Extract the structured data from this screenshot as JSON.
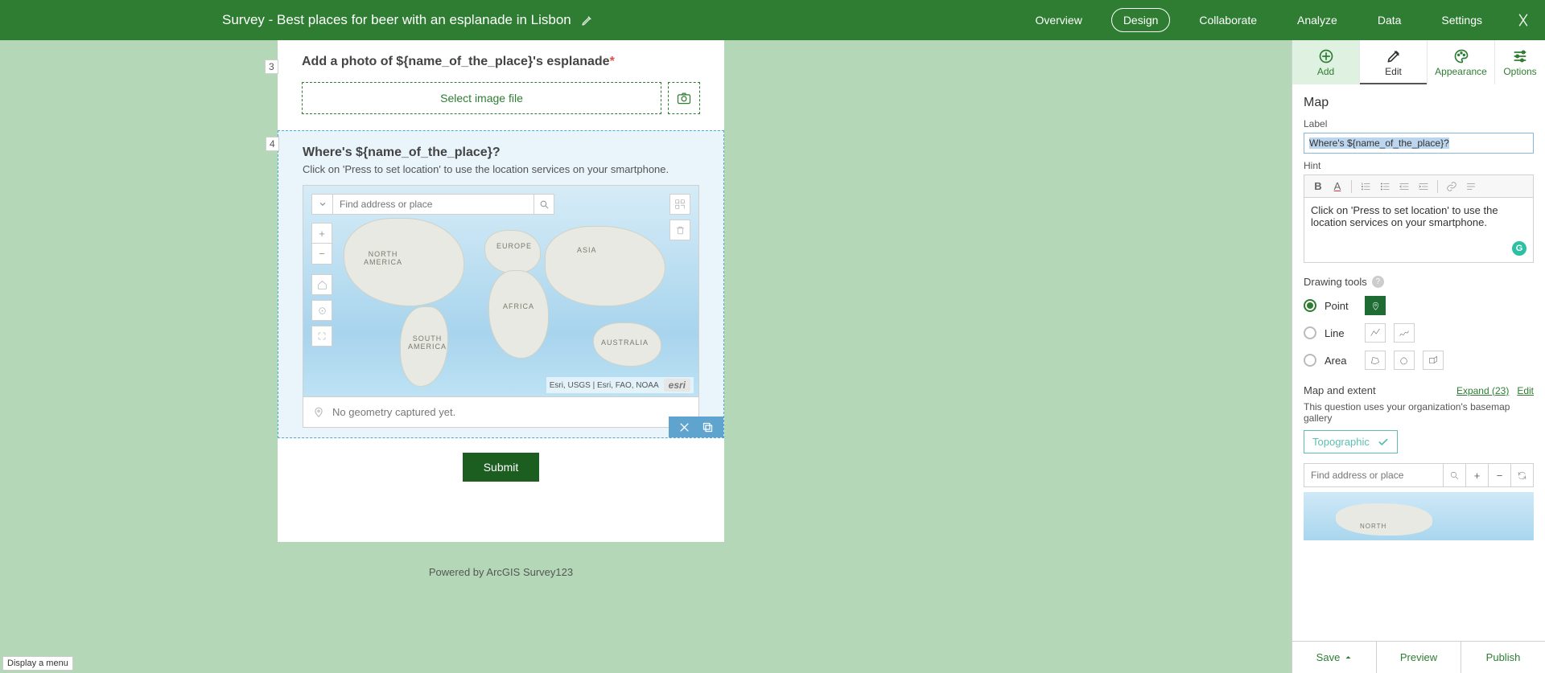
{
  "header": {
    "title": "Survey - Best places for beer with an esplanade in Lisbon",
    "nav": [
      "Overview",
      "Design",
      "Collaborate",
      "Analyze",
      "Data",
      "Settings"
    ],
    "active_nav": "Design"
  },
  "questions": {
    "q3": {
      "num": "3",
      "label": "Add a photo of ${name_of_the_place}'s esplanade",
      "select_file": "Select image file"
    },
    "q4": {
      "num": "4",
      "label": "Where's ${name_of_the_place}?",
      "hint": "Click on 'Press to set location' to use the location services on your smartphone.",
      "search_placeholder": "Find address or place",
      "attribution": "Esri, USGS | Esri, FAO, NOAA",
      "no_geom": "No geometry captured yet.",
      "continents": {
        "na": "NORTH\nAMERICA",
        "sa": "SOUTH\nAMERICA",
        "eu": "EUROPE",
        "af": "AFRICA",
        "as": "ASIA",
        "au": "AUSTRALIA"
      }
    }
  },
  "submit_label": "Submit",
  "powered": "Powered by ArcGIS Survey123",
  "panel": {
    "tabs": {
      "add": "Add",
      "edit": "Edit",
      "appearance": "Appearance",
      "options": "Options"
    },
    "section_title": "Map",
    "label_field": "Label",
    "label_value": "Where's ${name_of_the_place}?",
    "hint_field": "Hint",
    "hint_value": "Click on 'Press to set location' to use the location services on your smartphone.",
    "drawing_tools": "Drawing tools",
    "tool_point": "Point",
    "tool_line": "Line",
    "tool_area": "Area",
    "map_extent": "Map and extent",
    "expand": "Expand (23)",
    "edit_link": "Edit",
    "basemap_note": "This question uses your organization's basemap gallery",
    "basemap": "Topographic",
    "mini_placeholder": "Find address or place",
    "mini_label": "NORTH"
  },
  "footer": {
    "save": "Save",
    "preview": "Preview",
    "publish": "Publish"
  },
  "status_tip": "Display a menu"
}
